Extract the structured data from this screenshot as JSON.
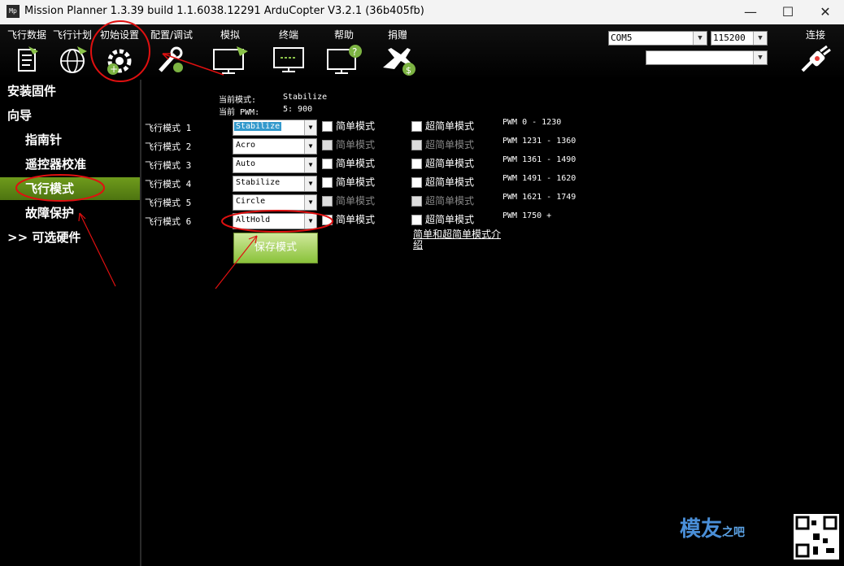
{
  "window": {
    "title": "Mission Planner 1.3.39 build 1.1.6038.12291 ArduCopter V3.2.1 (36b405fb)",
    "app_icon": "Mp"
  },
  "window_controls": {
    "minimize": "—",
    "maximize": "☐",
    "close": "✕"
  },
  "toolbar": {
    "items": [
      {
        "label": "飞行数据",
        "icon": "flight-data-icon"
      },
      {
        "label": "飞行计划",
        "icon": "flight-plan-globe-icon"
      },
      {
        "label": "初始设置",
        "icon": "initial-setup-gear-icon"
      },
      {
        "label": "配置/调试",
        "icon": "config-tuning-wrench-icon"
      },
      {
        "label": "模拟",
        "icon": "simulation-monitor-icon"
      },
      {
        "label": "终端",
        "icon": "terminal-monitor-icon"
      },
      {
        "label": "帮助",
        "icon": "help-monitor-icon"
      },
      {
        "label": "捐赠",
        "icon": "donate-plane-icon"
      }
    ],
    "port": "COM5",
    "baud": "115200",
    "profile": "",
    "connect_label": "连接"
  },
  "sidebar": {
    "items": [
      {
        "label": "安装固件",
        "level": "top"
      },
      {
        "label": "向导",
        "level": "top"
      },
      {
        "label": "指南针",
        "level": "sub"
      },
      {
        "label": "遥控器校准",
        "level": "sub"
      },
      {
        "label": "飞行模式",
        "level": "sub",
        "active": true
      },
      {
        "label": "故障保护",
        "level": "sub"
      },
      {
        "label": ">> 可选硬件",
        "level": "top"
      }
    ]
  },
  "status": {
    "current_mode_label": "当前模式:",
    "current_mode_value": "Stabilize",
    "current_pwm_label": "当前 PWM:",
    "current_pwm_value": "5: 900"
  },
  "modes": [
    {
      "label": "飞行模式 1",
      "value": "Stabilize",
      "simple": "简单模式",
      "super_simple": "超简单模式",
      "pwm": "PWM 0 - 1230",
      "enabled": true,
      "highlight": true
    },
    {
      "label": "飞行模式 2",
      "value": "Acro",
      "simple": "简单模式",
      "super_simple": "超简单模式",
      "pwm": "PWM 1231 - 1360",
      "enabled": false
    },
    {
      "label": "飞行模式 3",
      "value": "Auto",
      "simple": "简单模式",
      "super_simple": "超简单模式",
      "pwm": "PWM 1361 - 1490",
      "enabled": true
    },
    {
      "label": "飞行模式 4",
      "value": "Stabilize",
      "simple": "简单模式",
      "super_simple": "超简单模式",
      "pwm": "PWM 1491 - 1620",
      "enabled": true
    },
    {
      "label": "飞行模式 5",
      "value": "Circle",
      "simple": "简单模式",
      "super_simple": "超简单模式",
      "pwm": "PWM 1621 - 1749",
      "enabled": false
    },
    {
      "label": "飞行模式 6",
      "value": "AltHold",
      "simple": "简单模式",
      "super_simple": "超简单模式",
      "pwm": "PWM 1750 +",
      "enabled": true
    }
  ],
  "save_label": "保存模式",
  "help_link": "简单和超简单模式介绍",
  "watermark": {
    "main": "模友",
    "sub": "之吧"
  },
  "annotation_color": "#e01010",
  "accent_green": "#6f9b1c"
}
